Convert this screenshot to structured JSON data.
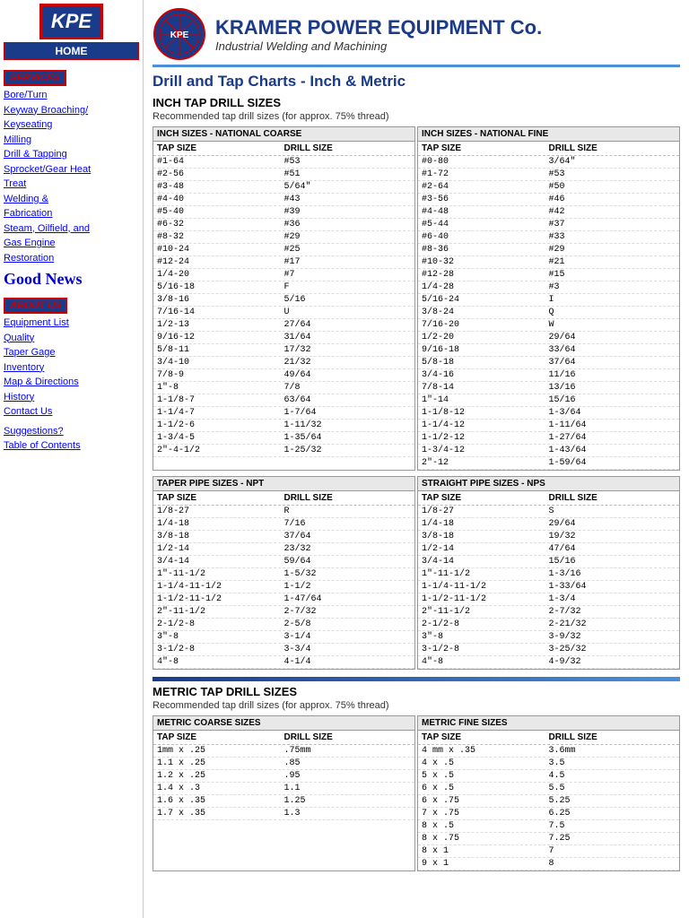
{
  "sidebar": {
    "logo_text": "KPE",
    "home_label": "HOME",
    "services_label": "SERVICES",
    "services_links": [
      "Bore/Turn",
      "Keyway Broaching/",
      "Keyseating",
      "Milling",
      "Drill & Tapping",
      "Sprocket/Gear Heat",
      "Treat",
      "Welding &",
      "Fabrication",
      "Steam, Oilfield, and",
      "Gas Engine",
      "Restoration"
    ],
    "good_news_label": "Good News",
    "about_label": "ABOUT US",
    "about_links": [
      "Equipment List",
      "Quality",
      "Taper Gage",
      "Inventory",
      "Map & Directions",
      "History",
      "Contact Us"
    ],
    "bottom_links": [
      "Suggestions?",
      "Table of Contents"
    ]
  },
  "header": {
    "company_name": "KRAMER POWER EQUIPMENT Co.",
    "tagline": "Industrial Welding and Machining",
    "page_title": "Drill and Tap Charts - Inch & Metric"
  },
  "inch_section": {
    "title": "INCH TAP DRILL SIZES",
    "desc": "Recommended tap drill sizes (for approx. 75% thread)",
    "national_coarse": {
      "header": "INCH SIZES - NATIONAL COARSE",
      "col1": "TAP SIZE",
      "col2": "DRILL SIZE",
      "rows": [
        [
          "#1-64",
          "#53"
        ],
        [
          "#2-56",
          "#51"
        ],
        [
          "#3-48",
          "5/64\""
        ],
        [
          "#4-40",
          "#43"
        ],
        [
          "#5-40",
          "#39"
        ],
        [
          "#6-32",
          "#36"
        ],
        [
          "#8-32",
          "#29"
        ],
        [
          "#10-24",
          "#25"
        ],
        [
          "#12-24",
          "#17"
        ],
        [
          "1/4-20",
          "#7"
        ],
        [
          "5/16-18",
          "F"
        ],
        [
          "3/8-16",
          "5/16"
        ],
        [
          "7/16-14",
          "U"
        ],
        [
          "1/2-13",
          "27/64"
        ],
        [
          "9/16-12",
          "31/64"
        ],
        [
          "5/8-11",
          "17/32"
        ],
        [
          "3/4-10",
          "21/32"
        ],
        [
          "7/8-9",
          "49/64"
        ],
        [
          "1\"-8",
          "7/8"
        ],
        [
          "1-1/8-7",
          "63/64"
        ],
        [
          "1-1/4-7",
          "1-7/64"
        ],
        [
          "1-1/2-6",
          "1-11/32"
        ],
        [
          "1-3/4-5",
          "1-35/64"
        ],
        [
          "2\"-4-1/2",
          "1-25/32"
        ]
      ]
    },
    "national_fine": {
      "header": "INCH SIZES - NATIONAL FINE",
      "col1": "TAP SIZE",
      "col2": "DRILL SIZE",
      "rows": [
        [
          "#0-80",
          "3/64\""
        ],
        [
          "#1-72",
          "#53"
        ],
        [
          "#2-64",
          "#50"
        ],
        [
          "#3-56",
          "#46"
        ],
        [
          "#4-48",
          "#42"
        ],
        [
          "#5-44",
          "#37"
        ],
        [
          "#6-40",
          "#33"
        ],
        [
          "#8-36",
          "#29"
        ],
        [
          "#10-32",
          "#21"
        ],
        [
          "#12-28",
          "#15"
        ],
        [
          "1/4-28",
          "#3"
        ],
        [
          "5/16-24",
          "I"
        ],
        [
          "3/8-24",
          "Q"
        ],
        [
          "7/16-20",
          "W"
        ],
        [
          "1/2-20",
          "29/64"
        ],
        [
          "9/16-18",
          "33/64"
        ],
        [
          "5/8-18",
          "37/64"
        ],
        [
          "3/4-16",
          "11/16"
        ],
        [
          "7/8-14",
          "13/16"
        ],
        [
          "1\"-14",
          "15/16"
        ],
        [
          "1-1/8-12",
          "1-3/64"
        ],
        [
          "1-1/4-12",
          "1-11/64"
        ],
        [
          "1-1/2-12",
          "1-27/64"
        ],
        [
          "1-3/4-12",
          "1-43/64"
        ],
        [
          "2\"-12",
          "1-59/64"
        ]
      ]
    },
    "taper_pipe": {
      "header": "TAPER PIPE SIZES - NPT",
      "col1": "TAP SIZE",
      "col2": "DRILL SIZE",
      "rows": [
        [
          "1/8-27",
          "R"
        ],
        [
          "1/4-18",
          "7/16"
        ],
        [
          "3/8-18",
          "37/64"
        ],
        [
          "1/2-14",
          "23/32"
        ],
        [
          "3/4-14",
          "59/64"
        ],
        [
          "1\"-11-1/2",
          "1-5/32"
        ],
        [
          "1-1/4-11-1/2",
          "1-1/2"
        ],
        [
          "1-1/2-11-1/2",
          "1-47/64"
        ],
        [
          "2\"-11-1/2",
          "2-7/32"
        ],
        [
          "2-1/2-8",
          "2-5/8"
        ],
        [
          "3\"-8",
          "3-1/4"
        ],
        [
          "3-1/2-8",
          "3-3/4"
        ],
        [
          "4\"-8",
          "4-1/4"
        ]
      ]
    },
    "straight_pipe": {
      "header": "STRAIGHT PIPE SIZES - NPS",
      "col1": "TAP SIZE",
      "col2": "DRILL SIZE",
      "rows": [
        [
          "1/8-27",
          "S"
        ],
        [
          "1/4-18",
          "29/64"
        ],
        [
          "3/8-18",
          "19/32"
        ],
        [
          "1/2-14",
          "47/64"
        ],
        [
          "3/4-14",
          "15/16"
        ],
        [
          "1\"-11-1/2",
          "1-3/16"
        ],
        [
          "1-1/4-11-1/2",
          "1-33/64"
        ],
        [
          "1-1/2-11-1/2",
          "1-3/4"
        ],
        [
          "2\"-11-1/2",
          "2-7/32"
        ],
        [
          "2-1/2-8",
          "2-21/32"
        ],
        [
          "3\"-8",
          "3-9/32"
        ],
        [
          "3-1/2-8",
          "3-25/32"
        ],
        [
          "4\"-8",
          "4-9/32"
        ]
      ]
    }
  },
  "metric_section": {
    "title": "METRIC TAP DRILL SIZES",
    "desc": "Recommended tap drill sizes (for approx. 75% thread)",
    "coarse": {
      "header": "METRIC COARSE SIZES",
      "col1": "TAP SIZE",
      "col2": "DRILL SIZE",
      "rows": [
        [
          "1mm x .25",
          ".75mm"
        ],
        [
          "1.1 x .25",
          ".85"
        ],
        [
          "1.2 x .25",
          ".95"
        ],
        [
          "1.4 x .3",
          "1.1"
        ],
        [
          "1.6 x .35",
          "1.25"
        ],
        [
          "1.7 x .35",
          "1.3"
        ]
      ]
    },
    "fine": {
      "header": "METRIC FINE SIZES",
      "col1": "TAP SIZE",
      "col2": "DRILL SIZE",
      "rows": [
        [
          "4 mm x .35",
          "3.6mm"
        ],
        [
          "4 x .5",
          "3.5"
        ],
        [
          "5 x .5",
          "4.5"
        ],
        [
          "6 x .5",
          "5.5"
        ],
        [
          "6 x .75",
          "5.25"
        ],
        [
          "7 x .75",
          "6.25"
        ],
        [
          "8 x .5",
          "7.5"
        ],
        [
          "8 x .75",
          "7.25"
        ],
        [
          "8 x 1",
          "7"
        ],
        [
          "9 x 1",
          "8"
        ]
      ]
    }
  }
}
